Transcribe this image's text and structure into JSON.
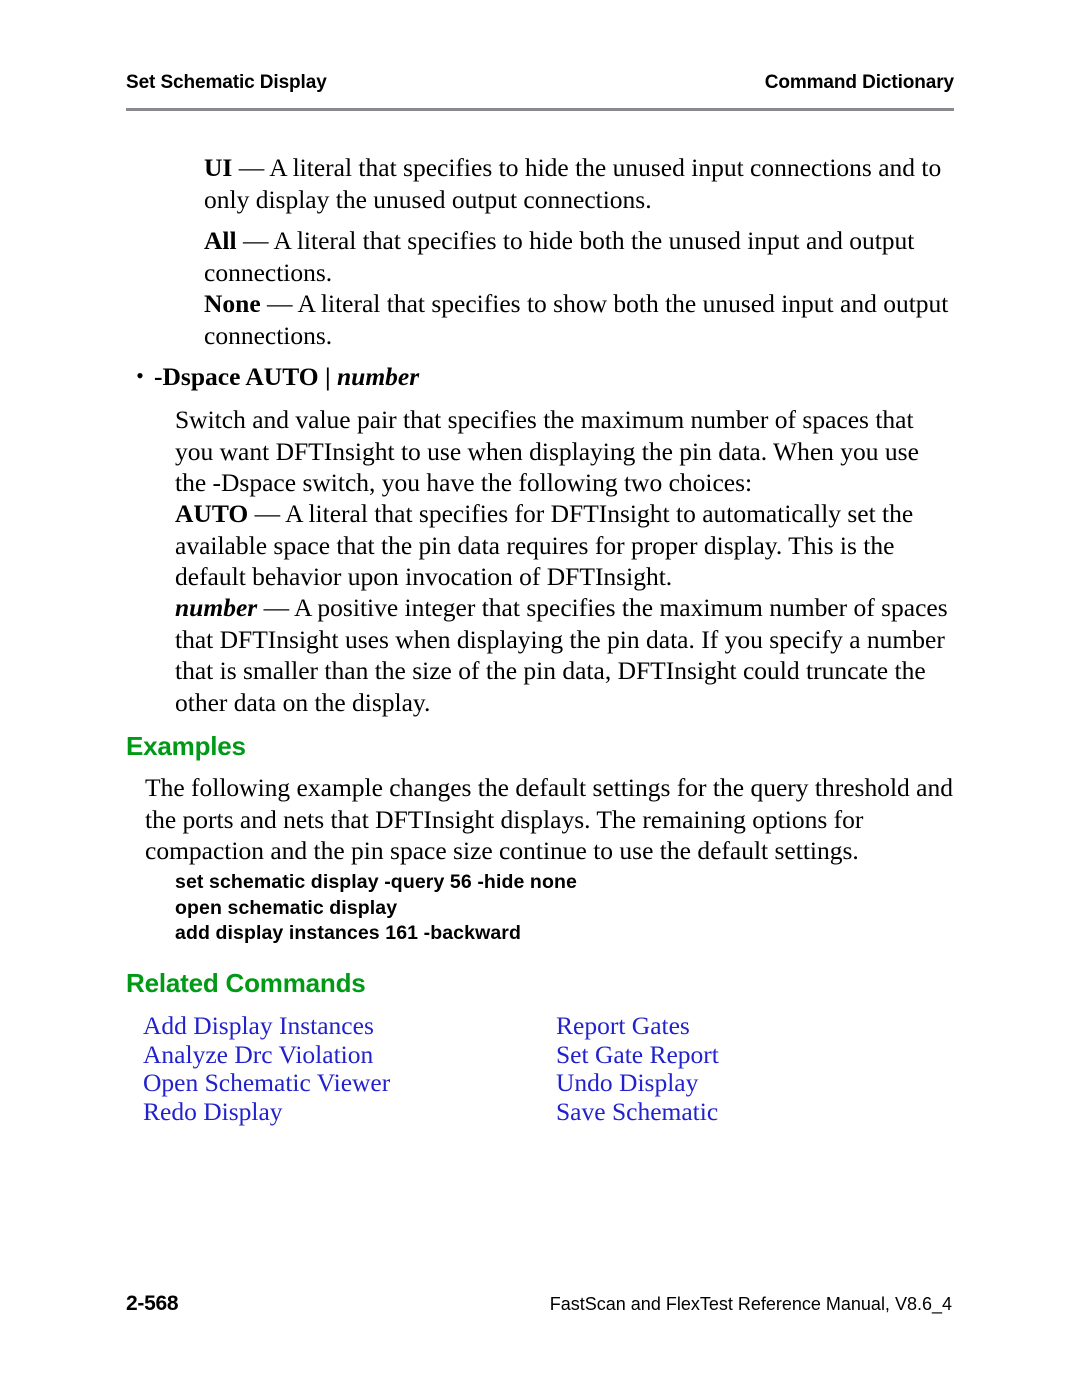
{
  "header": {
    "left": "Set Schematic Display",
    "right": "Command Dictionary"
  },
  "body": {
    "literals": [
      {
        "term": "UI",
        "dash": " — ",
        "text": "A literal that specifies to hide the unused input connections and to only display the unused output connections."
      },
      {
        "term": "All",
        "dash": " — ",
        "text": "A literal that specifies to hide both the unused input and output connections."
      },
      {
        "term": "None",
        "dash": " — ",
        "text": "A literal that specifies to show both the unused input and output connections."
      }
    ],
    "bullet": {
      "marker": "•",
      "switch": "-Dspace AUTO | ",
      "value": "number"
    },
    "bullet_desc": "Switch and value pair that specifies the maximum number of spaces that you want DFTInsight to use when displaying the pin data. When you use the -Dspace switch, you have the following two choices:",
    "choices": [
      {
        "term": "AUTO",
        "dash": " — ",
        "text": "A literal that specifies for DFTInsight to automatically set the available space that the pin data requires for proper display. This is the default behavior upon invocation of DFTInsight."
      },
      {
        "term": "number",
        "dash": " — ",
        "text": "A positive integer that specifies the maximum number of spaces that DFTInsight uses when displaying the pin data. If you specify a number that is smaller than the size of the pin data, DFTInsight could truncate the other data on the display."
      }
    ]
  },
  "examples": {
    "heading": "Examples",
    "paragraph": "The following example changes the default settings for the query threshold and the ports and nets that DFTInsight displays. The remaining options for compaction and the pin space size continue to use the default settings.",
    "code_lines": [
      "set schematic display -query 56 -hide none",
      "open schematic display",
      "add display instances 161 -backward"
    ]
  },
  "related": {
    "heading": "Related Commands",
    "rows": [
      {
        "left": "Add Display Instances",
        "right": "Report Gates"
      },
      {
        "left": "Analyze Drc Violation",
        "right": "Set Gate Report"
      },
      {
        "left": "Open Schematic Viewer",
        "right": "Undo Display"
      },
      {
        "left": "Redo Display",
        "right": "Save Schematic"
      }
    ]
  },
  "footer": {
    "page_number": "2-568",
    "manual": "FastScan and FlexTest Reference Manual, V8.6_4"
  },
  "colors": {
    "heading_green": "#009a16",
    "link_blue": "#2222cc",
    "rule_gray": "#8a8a8e",
    "text_black": "#000000"
  }
}
